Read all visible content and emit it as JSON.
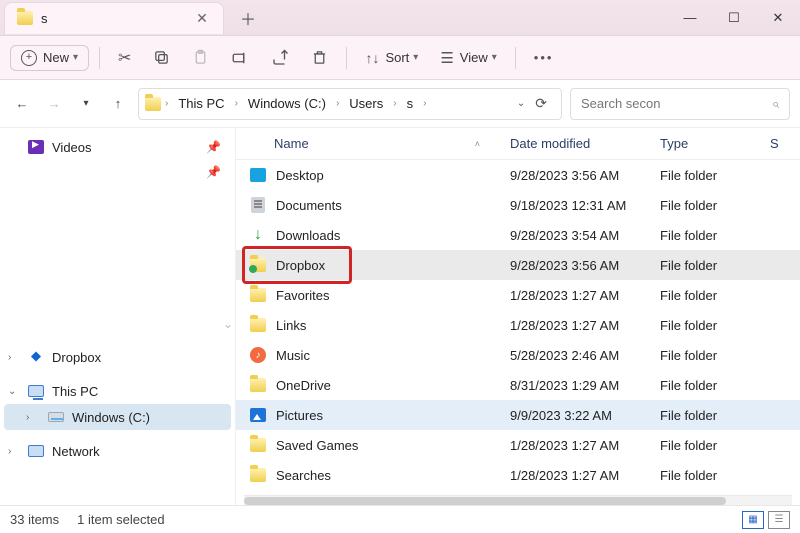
{
  "tab": {
    "title": "s"
  },
  "window": {
    "min": "—",
    "max": "☐",
    "close": "✕"
  },
  "toolbar": {
    "new_label": "New",
    "sort_label": "Sort",
    "view_label": "View"
  },
  "breadcrumb": {
    "items": [
      "This PC",
      "Windows (C:)",
      "Users",
      "s"
    ]
  },
  "search": {
    "placeholder": "Search secon"
  },
  "nav": {
    "videos": "Videos",
    "dropbox": "Dropbox",
    "this_pc": "This PC",
    "drive": "Windows (C:)",
    "network": "Network"
  },
  "columns": {
    "name": "Name",
    "date": "Date modified",
    "type": "Type",
    "size_initial": "S"
  },
  "rows": [
    {
      "icon": "desktop",
      "name": "Desktop",
      "date": "9/28/2023 3:56 AM",
      "type": "File folder"
    },
    {
      "icon": "docs",
      "name": "Documents",
      "date": "9/18/2023 12:31 AM",
      "type": "File folder"
    },
    {
      "icon": "down",
      "name": "Downloads",
      "date": "9/28/2023 3:54 AM",
      "type": "File folder"
    },
    {
      "icon": "dropbox",
      "name": "Dropbox",
      "date": "9/28/2023 3:56 AM",
      "type": "File folder",
      "selected": true,
      "highlight": true
    },
    {
      "icon": "folder",
      "name": "Favorites",
      "date": "1/28/2023 1:27 AM",
      "type": "File folder"
    },
    {
      "icon": "folder",
      "name": "Links",
      "date": "1/28/2023 1:27 AM",
      "type": "File folder"
    },
    {
      "icon": "music",
      "name": "Music",
      "date": "5/28/2023 2:46 AM",
      "type": "File folder"
    },
    {
      "icon": "folder",
      "name": "OneDrive",
      "date": "8/31/2023 1:29 AM",
      "type": "File folder"
    },
    {
      "icon": "pics",
      "name": "Pictures",
      "date": "9/9/2023 3:22 AM",
      "type": "File folder",
      "pictures": true
    },
    {
      "icon": "folder",
      "name": "Saved Games",
      "date": "1/28/2023 1:27 AM",
      "type": "File folder"
    },
    {
      "icon": "folder",
      "name": "Searches",
      "date": "1/28/2023 1:27 AM",
      "type": "File folder"
    }
  ],
  "status": {
    "count": "33 items",
    "selected": "1 item selected"
  }
}
